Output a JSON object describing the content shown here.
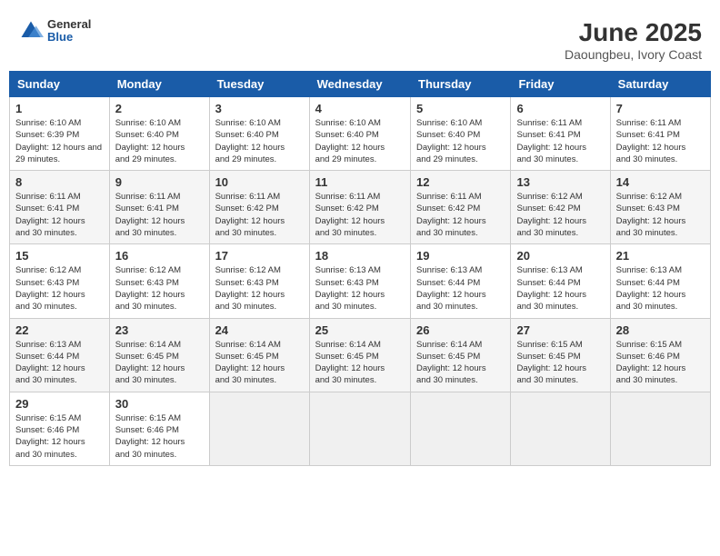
{
  "header": {
    "logo": {
      "general": "General",
      "blue": "Blue"
    },
    "title": "June 2025",
    "location": "Daoungbeu, Ivory Coast"
  },
  "calendar": {
    "days_of_week": [
      "Sunday",
      "Monday",
      "Tuesday",
      "Wednesday",
      "Thursday",
      "Friday",
      "Saturday"
    ],
    "weeks": [
      [
        null,
        {
          "num": "2",
          "sunrise": "6:10 AM",
          "sunset": "6:40 PM",
          "daylight": "12 hours and 29 minutes."
        },
        {
          "num": "3",
          "sunrise": "6:10 AM",
          "sunset": "6:40 PM",
          "daylight": "12 hours and 29 minutes."
        },
        {
          "num": "4",
          "sunrise": "6:10 AM",
          "sunset": "6:40 PM",
          "daylight": "12 hours and 29 minutes."
        },
        {
          "num": "5",
          "sunrise": "6:10 AM",
          "sunset": "6:40 PM",
          "daylight": "12 hours and 29 minutes."
        },
        {
          "num": "6",
          "sunrise": "6:11 AM",
          "sunset": "6:41 PM",
          "daylight": "12 hours and 30 minutes."
        },
        {
          "num": "7",
          "sunrise": "6:11 AM",
          "sunset": "6:41 PM",
          "daylight": "12 hours and 30 minutes."
        }
      ],
      [
        {
          "num": "8",
          "sunrise": "6:11 AM",
          "sunset": "6:41 PM",
          "daylight": "12 hours and 30 minutes."
        },
        {
          "num": "9",
          "sunrise": "6:11 AM",
          "sunset": "6:41 PM",
          "daylight": "12 hours and 30 minutes."
        },
        {
          "num": "10",
          "sunrise": "6:11 AM",
          "sunset": "6:42 PM",
          "daylight": "12 hours and 30 minutes."
        },
        {
          "num": "11",
          "sunrise": "6:11 AM",
          "sunset": "6:42 PM",
          "daylight": "12 hours and 30 minutes."
        },
        {
          "num": "12",
          "sunrise": "6:11 AM",
          "sunset": "6:42 PM",
          "daylight": "12 hours and 30 minutes."
        },
        {
          "num": "13",
          "sunrise": "6:12 AM",
          "sunset": "6:42 PM",
          "daylight": "12 hours and 30 minutes."
        },
        {
          "num": "14",
          "sunrise": "6:12 AM",
          "sunset": "6:43 PM",
          "daylight": "12 hours and 30 minutes."
        }
      ],
      [
        {
          "num": "15",
          "sunrise": "6:12 AM",
          "sunset": "6:43 PM",
          "daylight": "12 hours and 30 minutes."
        },
        {
          "num": "16",
          "sunrise": "6:12 AM",
          "sunset": "6:43 PM",
          "daylight": "12 hours and 30 minutes."
        },
        {
          "num": "17",
          "sunrise": "6:12 AM",
          "sunset": "6:43 PM",
          "daylight": "12 hours and 30 minutes."
        },
        {
          "num": "18",
          "sunrise": "6:13 AM",
          "sunset": "6:43 PM",
          "daylight": "12 hours and 30 minutes."
        },
        {
          "num": "19",
          "sunrise": "6:13 AM",
          "sunset": "6:44 PM",
          "daylight": "12 hours and 30 minutes."
        },
        {
          "num": "20",
          "sunrise": "6:13 AM",
          "sunset": "6:44 PM",
          "daylight": "12 hours and 30 minutes."
        },
        {
          "num": "21",
          "sunrise": "6:13 AM",
          "sunset": "6:44 PM",
          "daylight": "12 hours and 30 minutes."
        }
      ],
      [
        {
          "num": "22",
          "sunrise": "6:13 AM",
          "sunset": "6:44 PM",
          "daylight": "12 hours and 30 minutes."
        },
        {
          "num": "23",
          "sunrise": "6:14 AM",
          "sunset": "6:45 PM",
          "daylight": "12 hours and 30 minutes."
        },
        {
          "num": "24",
          "sunrise": "6:14 AM",
          "sunset": "6:45 PM",
          "daylight": "12 hours and 30 minutes."
        },
        {
          "num": "25",
          "sunrise": "6:14 AM",
          "sunset": "6:45 PM",
          "daylight": "12 hours and 30 minutes."
        },
        {
          "num": "26",
          "sunrise": "6:14 AM",
          "sunset": "6:45 PM",
          "daylight": "12 hours and 30 minutes."
        },
        {
          "num": "27",
          "sunrise": "6:15 AM",
          "sunset": "6:45 PM",
          "daylight": "12 hours and 30 minutes."
        },
        {
          "num": "28",
          "sunrise": "6:15 AM",
          "sunset": "6:46 PM",
          "daylight": "12 hours and 30 minutes."
        }
      ],
      [
        {
          "num": "29",
          "sunrise": "6:15 AM",
          "sunset": "6:46 PM",
          "daylight": "12 hours and 30 minutes."
        },
        {
          "num": "30",
          "sunrise": "6:15 AM",
          "sunset": "6:46 PM",
          "daylight": "12 hours and 30 minutes."
        },
        null,
        null,
        null,
        null,
        null
      ]
    ],
    "week1_sunday": {
      "num": "1",
      "sunrise": "6:10 AM",
      "sunset": "6:39 PM",
      "daylight": "12 hours and 29 minutes."
    }
  }
}
